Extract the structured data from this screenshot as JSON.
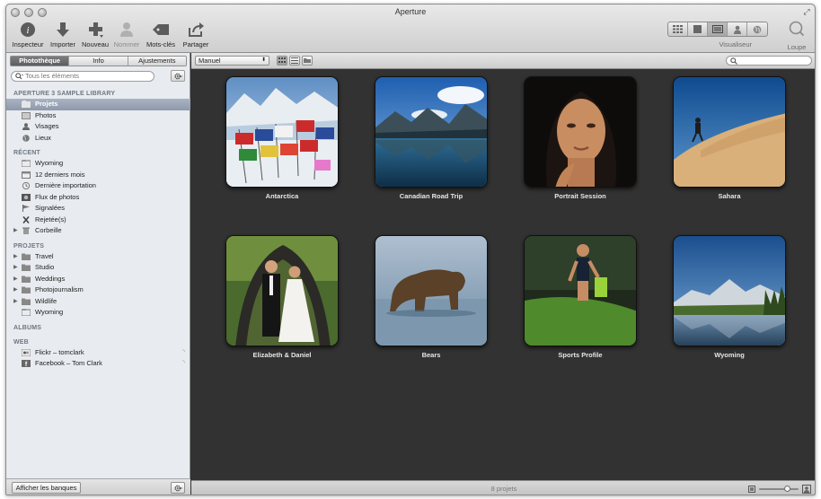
{
  "window": {
    "title": "Aperture"
  },
  "toolbar": {
    "inspector": "Inspecteur",
    "import": "Importer",
    "new": "Nouveau",
    "name": "Nommer",
    "keywords": "Mots-clés",
    "share": "Partager",
    "viewer": "Visualiseur",
    "loupe": "Loupe"
  },
  "sidebar": {
    "tabs": [
      "Photothèque",
      "Info",
      "Ajustements"
    ],
    "search_placeholder": "Tous les éléments",
    "library_title": "APERTURE 3 SAMPLE LIBRARY",
    "library_items": [
      "Projets",
      "Photos",
      "Visages",
      "Lieux"
    ],
    "recent_title": "RÉCENT",
    "recent_items": [
      "Wyoming",
      "12 derniers mois",
      "Dernière importation",
      "Flux de photos",
      "Signalées",
      "Rejetée(s)",
      "Corbeille"
    ],
    "projects_title": "PROJETS",
    "project_items": [
      "Travel",
      "Studio",
      "Weddings",
      "Photojournalism",
      "Wildlife",
      "Wyoming"
    ],
    "albums_title": "ALBUMS",
    "web_title": "WEB",
    "web_items": [
      "Flickr – tomclark",
      "Facebook – Tom Clark"
    ],
    "show_vaults": "Afficher les banques"
  },
  "browser": {
    "sort": "Manuel",
    "status": "8 projets",
    "zoom_level": 0.72,
    "projects": [
      "Antarctica",
      "Canadian Road Trip",
      "Portrait Session",
      "Sahara",
      "Elizabeth & Daniel",
      "Bears",
      "Sports Profile",
      "Wyoming"
    ]
  },
  "colors": {
    "selection": "#8e99ab",
    "grid_bg": "#323232"
  }
}
